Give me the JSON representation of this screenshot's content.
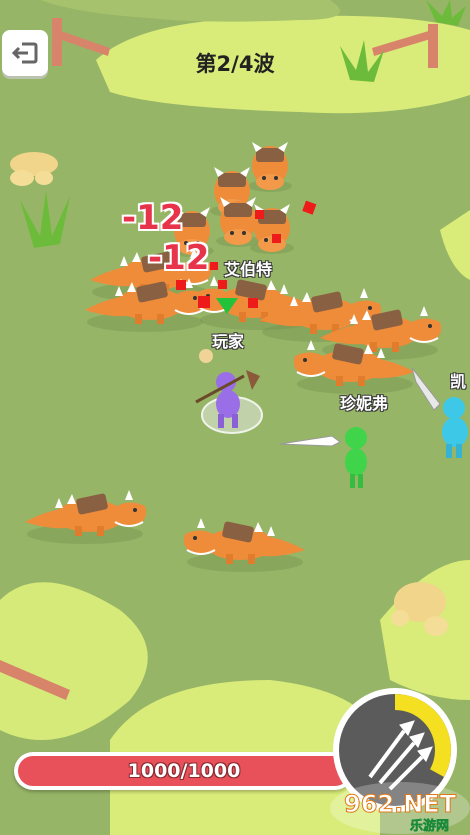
{
  "hud": {
    "back_icon": "back-arrow-icon",
    "wave_text": "第2/4波",
    "hp_text": "1000/1000",
    "hp_fraction": 1.0,
    "skill_icon": "triple-spear-icon",
    "skill_cooldown_fraction": 0.33
  },
  "damage_numbers": [
    "-12",
    "-12"
  ],
  "player_labels": {
    "player": "玩家",
    "ally_1": "珍妮弗",
    "ally_2": "凯",
    "enemy_target": "艾伯特"
  },
  "watermark": {
    "brand": "962.NET",
    "subtitle": "乐游网"
  },
  "colors": {
    "ground": "#97b567",
    "grass_patch": "#d9ec7a",
    "dino": "#ef8c3a",
    "hp_fill": "#e8505a",
    "skill_cooldown": "#f4e021",
    "player_purple": "#9a6ee6",
    "ally_green": "#3fd44a",
    "ally_cyan": "#3dc8e8"
  }
}
